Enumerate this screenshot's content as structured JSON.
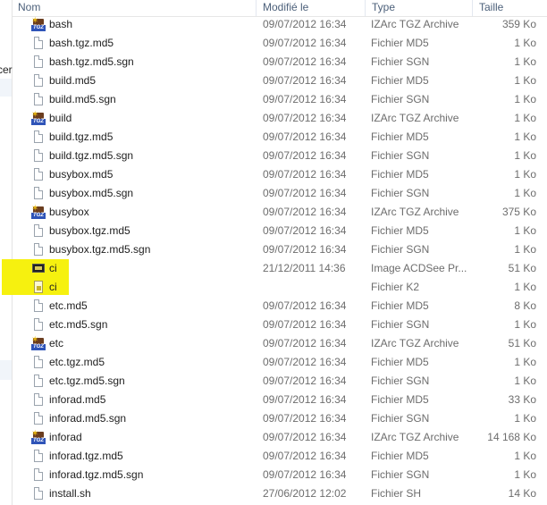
{
  "nav_pane": {
    "partial_label": "cer"
  },
  "colors": {
    "highlight": "#f6f10f",
    "header_text": "#4c607a",
    "detail_text": "#6d6d6d"
  },
  "columns": {
    "name": "Nom",
    "modified": "Modifié le",
    "type": "Type",
    "size": "Taille"
  },
  "files": [
    {
      "name": "bash",
      "date": "09/07/2012 16:34",
      "type": "IZArc TGZ Archive",
      "size": "359 Ko",
      "icon": "tgz-archive-icon"
    },
    {
      "name": "bash.tgz.md5",
      "date": "09/07/2012 16:34",
      "type": "Fichier MD5",
      "size": "1 Ko",
      "icon": "file-icon"
    },
    {
      "name": "bash.tgz.md5.sgn",
      "date": "09/07/2012 16:34",
      "type": "Fichier SGN",
      "size": "1 Ko",
      "icon": "file-icon"
    },
    {
      "name": "build.md5",
      "date": "09/07/2012 16:34",
      "type": "Fichier MD5",
      "size": "1 Ko",
      "icon": "file-icon"
    },
    {
      "name": "build.md5.sgn",
      "date": "09/07/2012 16:34",
      "type": "Fichier SGN",
      "size": "1 Ko",
      "icon": "file-icon"
    },
    {
      "name": "build",
      "date": "09/07/2012 16:34",
      "type": "IZArc TGZ Archive",
      "size": "1 Ko",
      "icon": "tgz-archive-icon"
    },
    {
      "name": "build.tgz.md5",
      "date": "09/07/2012 16:34",
      "type": "Fichier MD5",
      "size": "1 Ko",
      "icon": "file-icon"
    },
    {
      "name": "build.tgz.md5.sgn",
      "date": "09/07/2012 16:34",
      "type": "Fichier SGN",
      "size": "1 Ko",
      "icon": "file-icon"
    },
    {
      "name": "busybox.md5",
      "date": "09/07/2012 16:34",
      "type": "Fichier MD5",
      "size": "1 Ko",
      "icon": "file-icon"
    },
    {
      "name": "busybox.md5.sgn",
      "date": "09/07/2012 16:34",
      "type": "Fichier SGN",
      "size": "1 Ko",
      "icon": "file-icon"
    },
    {
      "name": "busybox",
      "date": "09/07/2012 16:34",
      "type": "IZArc TGZ Archive",
      "size": "375 Ko",
      "icon": "tgz-archive-icon"
    },
    {
      "name": "busybox.tgz.md5",
      "date": "09/07/2012 16:34",
      "type": "Fichier MD5",
      "size": "1 Ko",
      "icon": "file-icon"
    },
    {
      "name": "busybox.tgz.md5.sgn",
      "date": "09/07/2012 16:34",
      "type": "Fichier SGN",
      "size": "1 Ko",
      "icon": "file-icon"
    },
    {
      "name": "ci",
      "date": "21/12/2011 14:36",
      "type": "Image ACDSee Pr...",
      "size": "51 Ko",
      "icon": "image-icon"
    },
    {
      "name": "ci",
      "date": "",
      "type": "Fichier K2",
      "size": "1 Ko",
      "icon": "k2-file-icon"
    },
    {
      "name": "etc.md5",
      "date": "09/07/2012 16:34",
      "type": "Fichier MD5",
      "size": "8 Ko",
      "icon": "file-icon"
    },
    {
      "name": "etc.md5.sgn",
      "date": "09/07/2012 16:34",
      "type": "Fichier SGN",
      "size": "1 Ko",
      "icon": "file-icon"
    },
    {
      "name": "etc",
      "date": "09/07/2012 16:34",
      "type": "IZArc TGZ Archive",
      "size": "51 Ko",
      "icon": "tgz-archive-icon"
    },
    {
      "name": "etc.tgz.md5",
      "date": "09/07/2012 16:34",
      "type": "Fichier MD5",
      "size": "1 Ko",
      "icon": "file-icon"
    },
    {
      "name": "etc.tgz.md5.sgn",
      "date": "09/07/2012 16:34",
      "type": "Fichier SGN",
      "size": "1 Ko",
      "icon": "file-icon"
    },
    {
      "name": "inforad.md5",
      "date": "09/07/2012 16:34",
      "type": "Fichier MD5",
      "size": "33 Ko",
      "icon": "file-icon"
    },
    {
      "name": "inforad.md5.sgn",
      "date": "09/07/2012 16:34",
      "type": "Fichier SGN",
      "size": "1 Ko",
      "icon": "file-icon"
    },
    {
      "name": "inforad",
      "date": "09/07/2012 16:34",
      "type": "IZArc TGZ Archive",
      "size": "14 168 Ko",
      "icon": "tgz-archive-icon"
    },
    {
      "name": "inforad.tgz.md5",
      "date": "09/07/2012 16:34",
      "type": "Fichier MD5",
      "size": "1 Ko",
      "icon": "file-icon"
    },
    {
      "name": "inforad.tgz.md5.sgn",
      "date": "09/07/2012 16:34",
      "type": "Fichier SGN",
      "size": "1 Ko",
      "icon": "file-icon"
    },
    {
      "name": "install.sh",
      "date": "27/06/2012 12:02",
      "type": "Fichier SH",
      "size": "14 Ko",
      "icon": "file-icon"
    }
  ],
  "tgz_icon_text": "TGZ"
}
